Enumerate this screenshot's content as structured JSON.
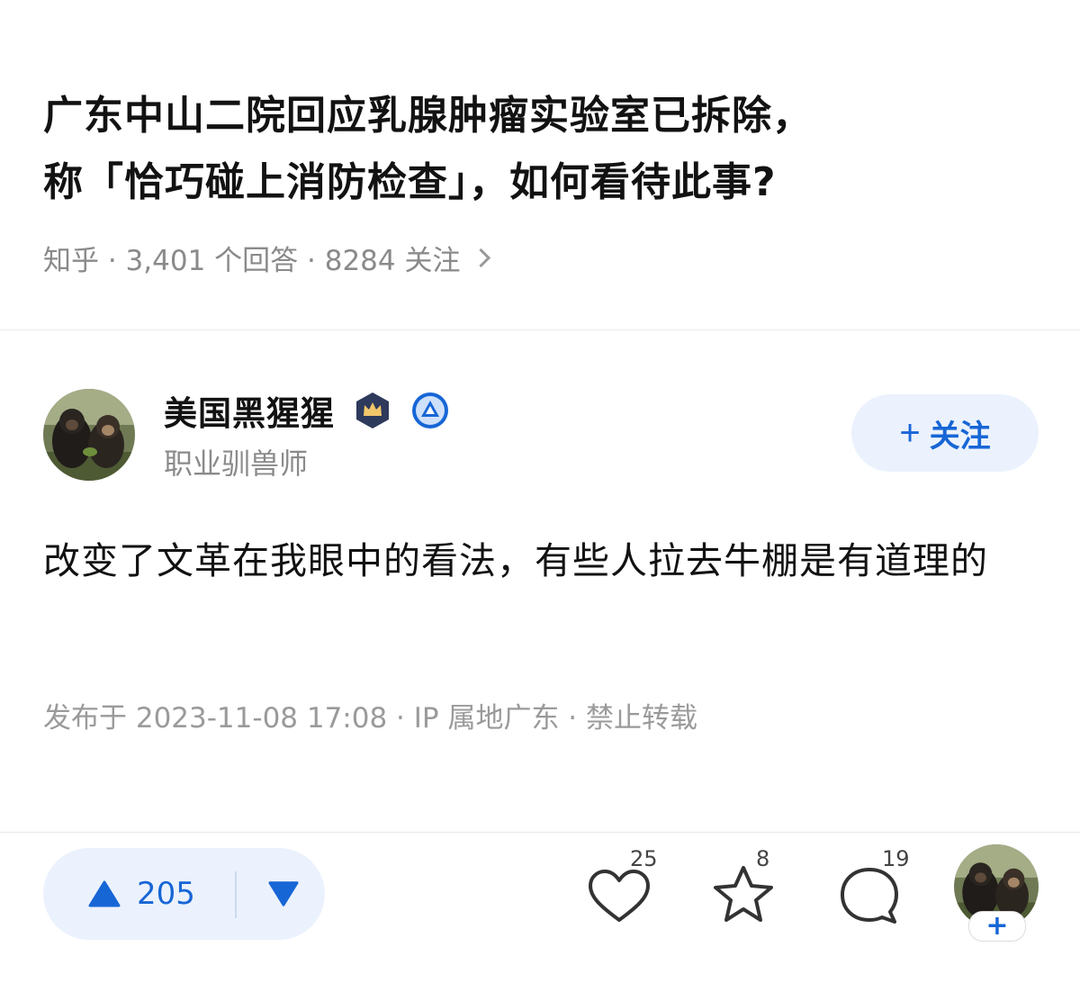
{
  "question": {
    "title_line1": "广东中山二院回应乳腺肿瘤实验室已拆除，",
    "title_line2": "称「恰巧碰上消防检查」，如何看待此事?",
    "meta": "知乎 · 3,401 个回答 · 8284 关注"
  },
  "author": {
    "name": "美国黑猩猩",
    "bio": "职业驯兽师",
    "follow_label": "关注",
    "follow_plus": "+",
    "avatar": "chimpanzee-avatar",
    "badges": [
      "crown-badge-icon",
      "triangle-badge-icon"
    ]
  },
  "answer": {
    "content": "改变了文革在我眼中的看法，有些人拉去牛棚是有道理的",
    "publish_info": "发布于 2023-11-08 17:08 · IP 属地广东 · 禁止转载"
  },
  "actions": {
    "upvote_count": "205",
    "likes": "25",
    "favorites": "8",
    "comments": "19",
    "add_label": "+",
    "icons": [
      "upvote-icon",
      "downvote-icon",
      "heart-icon",
      "star-icon",
      "comment-icon"
    ]
  },
  "colors": {
    "accent": "#1766d6",
    "accent_bg": "#ebf2fd",
    "muted_text": "#8a8a8a"
  }
}
